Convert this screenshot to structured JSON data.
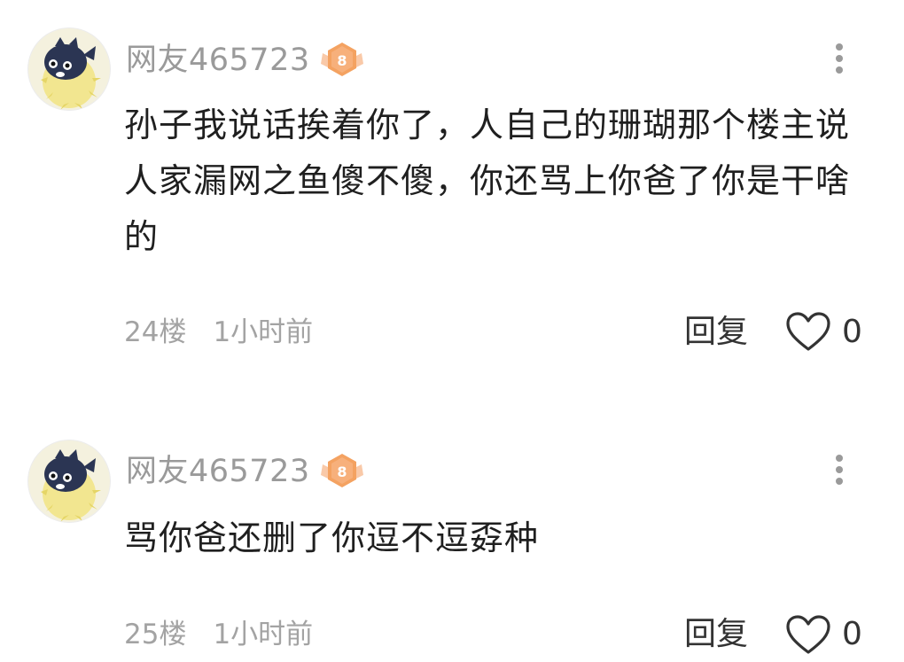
{
  "comments": [
    {
      "username": "网友465723",
      "level": "8",
      "avatar_icon": "pufferfish-avatar",
      "content": "孙子我说话挨着你了，人自己的珊瑚那个楼主说人家漏网之鱼傻不傻，你还骂上你爸了你是干啥的",
      "floor": "24楼",
      "time": "1小时前",
      "reply_label": "回复",
      "like_count": "0"
    },
    {
      "username": "网友465723",
      "level": "8",
      "avatar_icon": "pufferfish-avatar",
      "content": "骂你爸还删了你逗不逗孬种",
      "floor": "25楼",
      "time": "1小时前",
      "reply_label": "回复",
      "like_count": "0"
    }
  ],
  "icons": {
    "more": "more-vertical-icon",
    "like": "heart-outline-icon",
    "badge": "level-badge-icon"
  },
  "colors": {
    "username": "#9a9a9a",
    "content": "#1f1f1f",
    "meta": "#a3a3a3",
    "badge": "#f4a261"
  }
}
